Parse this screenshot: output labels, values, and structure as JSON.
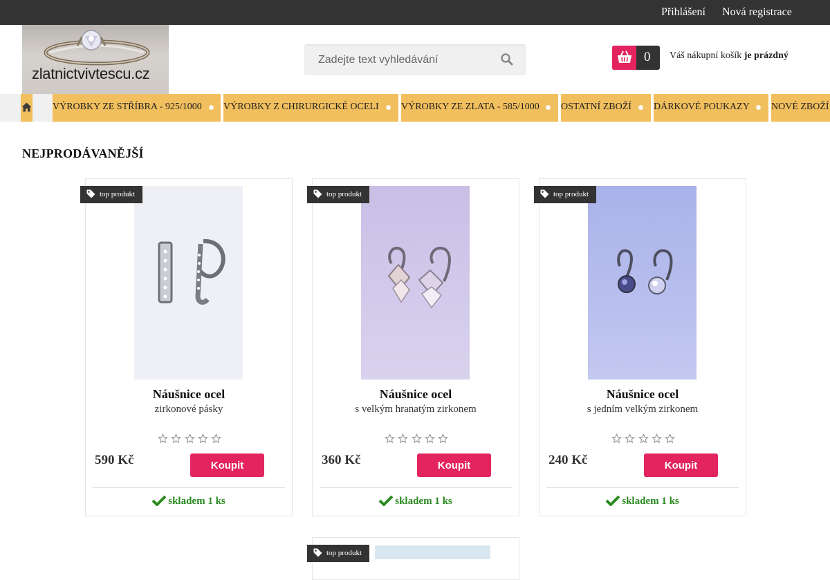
{
  "header": {
    "login_label": "Přihlášení",
    "register_label": "Nová registrace",
    "logo_text": "zlatnictvivtescu.cz",
    "search_placeholder": "Zadejte text vyhledávání",
    "search_icon": "search-icon",
    "cart": {
      "count": "0",
      "text_prefix": "Váš nákupní košík",
      "text_state": "je prázdný",
      "icon": "basket-icon",
      "accent_color": "#e3245f"
    }
  },
  "nav": {
    "home_icon": "home-icon",
    "items": [
      {
        "label": "VÝROBKY ZE STŘÍBRA - 925/1000"
      },
      {
        "label": "VÝROBKY Z CHIRURGICKÉ OCELI"
      },
      {
        "label": "VÝROBKY ZE ZLATA - 585/1000"
      },
      {
        "label": "OSTATNÍ ZBOŽÍ"
      },
      {
        "label": "DÁRKOVÉ POUKAZY"
      },
      {
        "label": "NOVÉ ZBOŽÍ"
      }
    ],
    "background_color": "#f2bf5e"
  },
  "main": {
    "section_title": "NEJPRODÁVANĚJŠÍ",
    "products": [
      {
        "badge": "top produkt",
        "name": "Náušnice ocel",
        "description": "zirkonové pásky",
        "price": "590 Kč",
        "buy_label": "Koupit",
        "stock": "skladem 1 ks",
        "rating": 0
      },
      {
        "badge": "top produkt",
        "name": "Náušnice ocel",
        "description": "s velkým hranatým zirkonem",
        "price": "360 Kč",
        "buy_label": "Koupit",
        "stock": "skladem 1 ks",
        "rating": 0
      },
      {
        "badge": "top produkt",
        "name": "Náušnice ocel",
        "description": "s jedním velkým zirkonem",
        "price": "240 Kč",
        "buy_label": "Koupit",
        "stock": "skladem 1 ks",
        "rating": 0
      }
    ],
    "partial_product": {
      "badge": "top produkt"
    }
  },
  "colors": {
    "topbar": "#333333",
    "buy_button": "#e3245f",
    "stock_green": "#2a8a1f"
  }
}
